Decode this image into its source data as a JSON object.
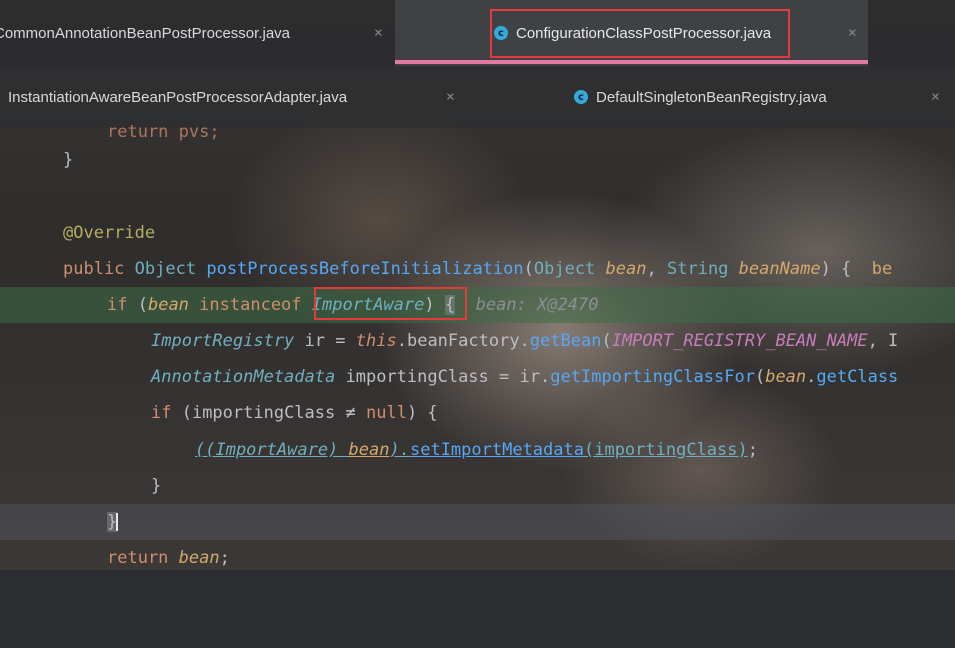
{
  "tabs_row1": [
    {
      "name": "CommonAnnotationBeanPostProcessor.java",
      "active": false
    },
    {
      "name": "ConfigurationClassPostProcessor.java",
      "active": true
    }
  ],
  "tabs_row2": [
    {
      "name": "InstantiationAwareBeanPostProcessorAdapter.java",
      "active": false
    },
    {
      "name": "DefaultSingletonBeanRegistry.java",
      "active": false
    }
  ],
  "icons": {
    "file": "java-class-icon",
    "close": "close-icon"
  },
  "close_glyph": "×",
  "file_icon_letter": "c",
  "colors": {
    "keyword": "#cf8e6d",
    "annotation": "#b3ae60",
    "method": "#56a8f5",
    "type": "#6fafbd",
    "param": "#d4a86b",
    "constant": "#c77dbb",
    "active_tab_underline": "#e07aa2",
    "highlight_box": "#e23b3b",
    "debug_line": "#3c6e46"
  },
  "code": {
    "l0": {
      "text": "return pvs;"
    },
    "l1": {
      "brace": "}"
    },
    "l3": {
      "annotation": "@Override"
    },
    "l4": {
      "kw_public": "public",
      "t_object": "Object",
      "method": "postProcessBeforeInitialization",
      "open": "(",
      "t_object2": "Object",
      "p_bean": "bean",
      "comma": ",",
      "t_string": "String",
      "p_beanName": "beanName",
      "close": ") {",
      "hint": "be"
    },
    "l5": {
      "kw_if": "if",
      "open": " (",
      "p_bean": "bean",
      "kw_instanceof": "instanceof",
      "t_importaware": "ImportAware",
      "close": ")",
      "brace": "{",
      "hint": "bean: X@2470"
    },
    "l6": {
      "t_registry": "ImportRegistry",
      "rest1": "ir",
      "eq": "=",
      "kw_this": "this",
      "rest2": ".beanFactory.",
      "method": "getBean",
      "open": "(",
      "const": "IMPORT_REGISTRY_BEAN_NAME",
      "rest3": ", I"
    },
    "l7": {
      "t_meta": "AnnotationMetadata",
      "rest1": "importingClass",
      "eq": "=",
      "rest2": "ir.",
      "method": "getImportingClassFor",
      "open": "(",
      "p_bean": "bean",
      "rest3": ".",
      "method2": "getClass"
    },
    "l8": {
      "kw_if": "if",
      "open": " (importingClass ",
      "op": "≠",
      "kw_null": "null",
      "close": ") {"
    },
    "l9": {
      "cast": "((ImportAware) ",
      "p_bean": "bean",
      "close_paren": ")",
      "dot": ".",
      "method": "setImportMetadata",
      "args": "(importingClass)",
      "semi": ";"
    },
    "l10": {
      "brace": "}"
    },
    "l11": {
      "brace": "}"
    },
    "l12": {
      "kw_return": "return",
      "p_bean": "bean",
      "semi": ";"
    }
  }
}
